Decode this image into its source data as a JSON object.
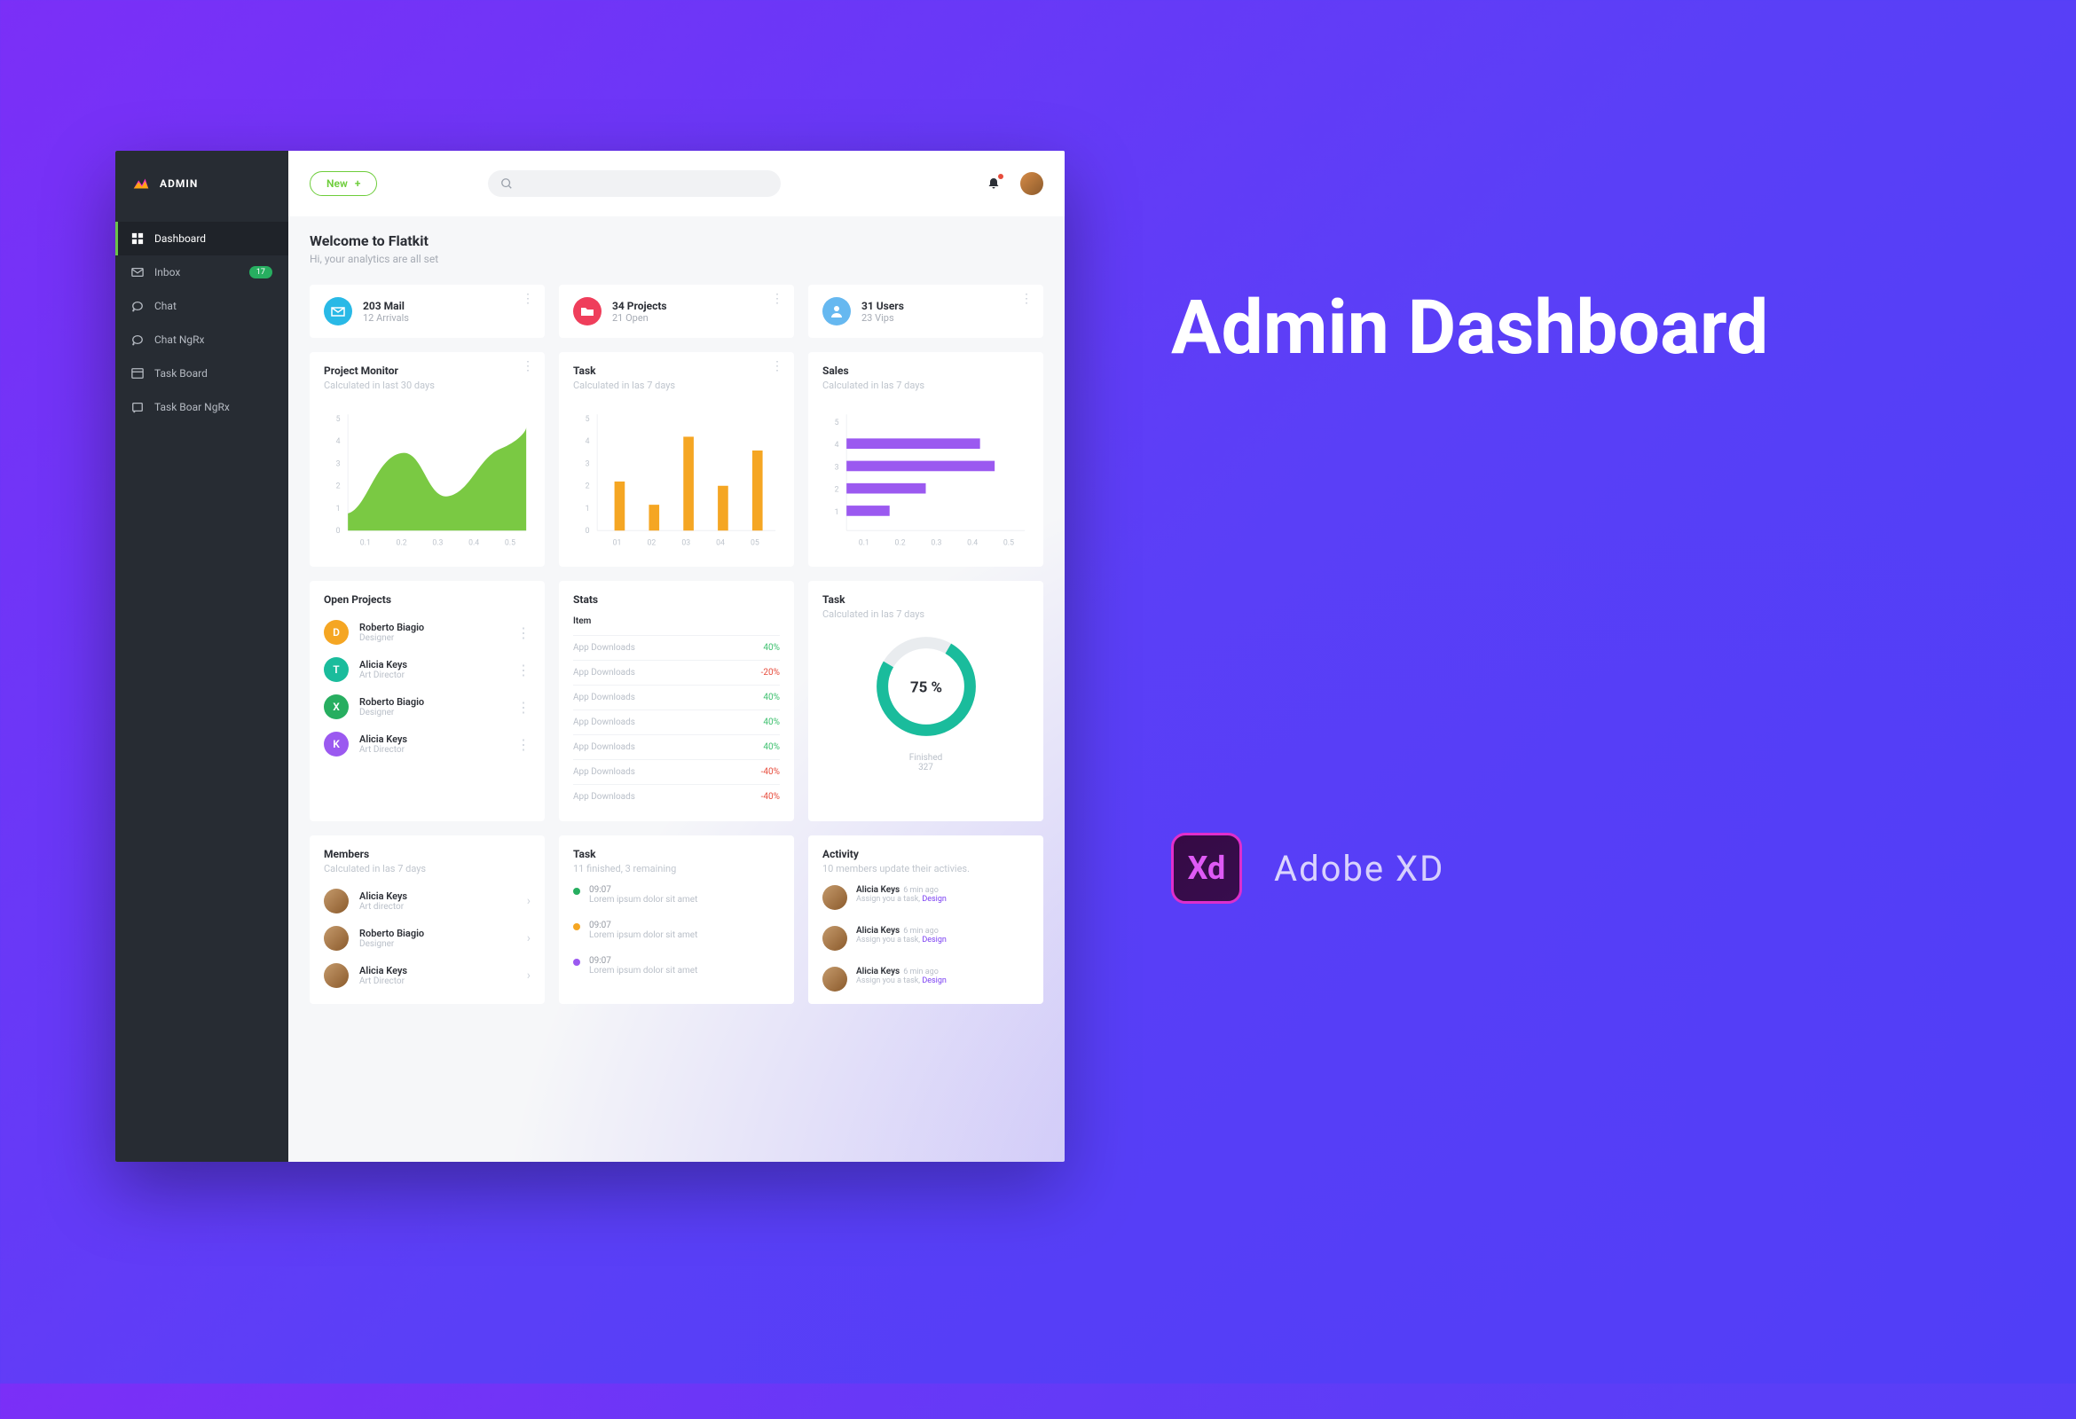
{
  "marketing": {
    "title": "Admin Dashboard",
    "tool": "Adobe XD",
    "xd": "Xd"
  },
  "app": {
    "name": "ADMIN"
  },
  "sidebar": {
    "items": [
      {
        "label": "Dashboard"
      },
      {
        "label": "Inbox",
        "badge": "17"
      },
      {
        "label": "Chat"
      },
      {
        "label": "Chat NgRx"
      },
      {
        "label": "Task Board"
      },
      {
        "label": "Task Boar NgRx"
      }
    ]
  },
  "topbar": {
    "new": "New"
  },
  "welcome": {
    "title": "Welcome to Flatkit",
    "subtitle": "Hi, your analytics are all set"
  },
  "stats": [
    {
      "title": "203 Mail",
      "sub": "12 Arrivals"
    },
    {
      "title": "34 Projects",
      "sub": "21 Open"
    },
    {
      "title": "31 Users",
      "sub": "23 Vips"
    }
  ],
  "charts": {
    "monitor": {
      "title": "Project Monitor",
      "sub": "Calculated in last 30 days"
    },
    "task": {
      "title": "Task",
      "sub": "Calculated in las 7 days"
    },
    "sales": {
      "title": "Sales",
      "sub": "Calculated in las 7 days"
    }
  },
  "chart_data": [
    {
      "type": "area",
      "title": "Project Monitor",
      "x": [
        0.1,
        0.2,
        0.3,
        0.4,
        0.5
      ],
      "yticks": [
        0,
        1,
        2,
        3,
        4,
        5
      ],
      "values": [
        1.2,
        3.8,
        2.2,
        3.2,
        4.8
      ],
      "color": "#7ac943"
    },
    {
      "type": "bar",
      "title": "Task",
      "categories": [
        "01",
        "02",
        "03",
        "04",
        "05"
      ],
      "yticks": [
        0,
        1,
        2,
        3,
        4,
        5
      ],
      "values": [
        2.2,
        1.2,
        4.2,
        2.0,
        3.6
      ],
      "color": "#f5a623"
    },
    {
      "type": "bar",
      "orientation": "horizontal",
      "title": "Sales",
      "categories": [
        "5",
        "4",
        "3",
        "2",
        "1"
      ],
      "xticks": [
        0.1,
        0.2,
        0.3,
        0.4,
        0.5
      ],
      "values": [
        0,
        0.38,
        0.42,
        0.22,
        0.12
      ],
      "color": "#9b59f0"
    }
  ],
  "openProjects": {
    "title": "Open Projects",
    "items": [
      {
        "initial": "D",
        "color": "#f5a623",
        "name": "Roberto Biagio",
        "role": "Designer"
      },
      {
        "initial": "T",
        "color": "#1abc9c",
        "name": "Alicia Keys",
        "role": "Art Director"
      },
      {
        "initial": "X",
        "color": "#27ae60",
        "name": "Roberto Biagio",
        "role": "Designer"
      },
      {
        "initial": "K",
        "color": "#9b59f0",
        "name": "Alicia Keys",
        "role": "Art Director"
      }
    ]
  },
  "statsTable": {
    "title": "Stats",
    "head": "Item",
    "rows": [
      {
        "label": "App Downloads",
        "val": "40%"
      },
      {
        "label": "App Downloads",
        "val": "-20%"
      },
      {
        "label": "App Downloads",
        "val": "40%"
      },
      {
        "label": "App Downloads",
        "val": "40%"
      },
      {
        "label": "App Downloads",
        "val": "40%"
      },
      {
        "label": "App Downloads",
        "val": "-40%"
      },
      {
        "label": "App Downloads",
        "val": "-40%"
      }
    ]
  },
  "donut": {
    "title": "Task",
    "sub": "Calculated in las 7 days",
    "percent": "75 %",
    "finished": "Finished",
    "count": "327"
  },
  "members": {
    "title": "Members",
    "sub": "Calculated in las 7 days",
    "items": [
      {
        "name": "Alicia Keys",
        "role": "Art director"
      },
      {
        "name": "Roberto Biagio",
        "role": "Designer"
      },
      {
        "name": "Alicia Keys",
        "role": "Art Director"
      }
    ]
  },
  "timelineCard": {
    "title": "Task",
    "sub": "11 finished, 3 remaining",
    "items": [
      {
        "color": "#27ae60",
        "time": "09:07",
        "text": "Lorem ipsum dolor sit amet"
      },
      {
        "color": "#f5a623",
        "time": "09:07",
        "text": "Lorem ipsum dolor sit amet"
      },
      {
        "color": "#9b59f0",
        "time": "09:07",
        "text": "Lorem ipsum dolor sit amet"
      }
    ]
  },
  "activity": {
    "title": "Activity",
    "sub": "10 members update their activies.",
    "items": [
      {
        "name": "Alicia Keys",
        "meta": "6  min ago",
        "text": "Assign you a task, ",
        "link": "Design"
      },
      {
        "name": "Alicia Keys",
        "meta": "6  min ago",
        "text": "Assign you a task, ",
        "link": "Design"
      },
      {
        "name": "Alicia Keys",
        "meta": "6  min ago",
        "text": "Assign you a task, ",
        "link": "Design"
      }
    ]
  }
}
